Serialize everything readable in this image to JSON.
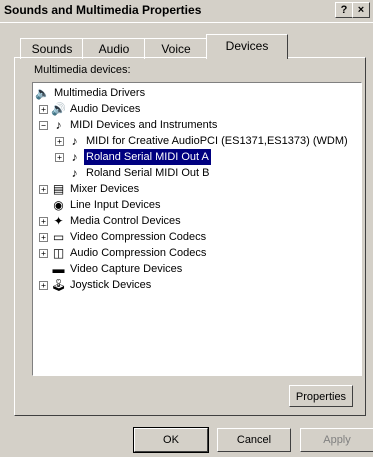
{
  "window": {
    "title": "Sounds and Multimedia Properties",
    "help_label": "?",
    "close_label": "×"
  },
  "tabs": [
    {
      "label": "Sounds"
    },
    {
      "label": "Audio"
    },
    {
      "label": "Voice"
    },
    {
      "label": "Devices",
      "active": true
    }
  ],
  "panel": {
    "label": "Multimedia devices:"
  },
  "tree": [
    {
      "label": "Multimedia Drivers",
      "icon": "speaker-icon",
      "expander": ""
    },
    {
      "label": "Audio Devices",
      "icon": "audio-device-icon",
      "expander": "+"
    },
    {
      "label": "MIDI Devices and Instruments",
      "icon": "midi-icon",
      "expander": "−"
    },
    {
      "label": "MIDI for Creative AudioPCI (ES1371,ES1373) (WDM)",
      "icon": "midi-icon",
      "expander": "+"
    },
    {
      "label": "Roland Serial MIDI Out A",
      "icon": "midi-icon",
      "expander": "+",
      "selected": true
    },
    {
      "label": "Roland Serial MIDI Out B",
      "icon": "midi-icon",
      "expander": ""
    },
    {
      "label": "Mixer Devices",
      "icon": "mixer-icon",
      "expander": "+"
    },
    {
      "label": "Line Input Devices",
      "icon": "line-input-icon",
      "expander": ""
    },
    {
      "label": "Media Control Devices",
      "icon": "media-control-icon",
      "expander": "+"
    },
    {
      "label": "Video Compression Codecs",
      "icon": "video-codec-icon",
      "expander": "+"
    },
    {
      "label": "Audio Compression Codecs",
      "icon": "audio-codec-icon",
      "expander": "+"
    },
    {
      "label": "Video Capture Devices",
      "icon": "video-capture-icon",
      "expander": ""
    },
    {
      "label": "Joystick Devices",
      "icon": "joystick-icon",
      "expander": "+"
    }
  ],
  "buttons": {
    "properties": "Properties",
    "ok": "OK",
    "cancel": "Cancel",
    "apply": "Apply"
  }
}
